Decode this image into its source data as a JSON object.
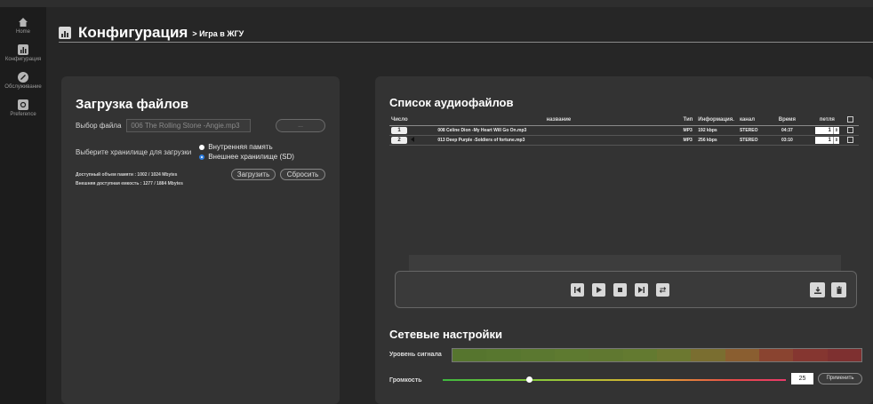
{
  "sidebar": {
    "items": [
      {
        "label": "Home",
        "icon": "home-icon"
      },
      {
        "label": "Конфигурация",
        "icon": "chart-icon"
      },
      {
        "label": "Обслуживание",
        "icon": "wrench-icon"
      },
      {
        "label": "Preference",
        "icon": "gear-icon"
      }
    ]
  },
  "header": {
    "title": "Конфигурация",
    "breadcrumb": "> Игра в ЖГУ"
  },
  "upload": {
    "title": "Загрузка файлов",
    "file_label": "Выбор файла",
    "file_value": "006 The Rolling Stone -Angie.mp3",
    "browse_label": "...",
    "storage_label": "Выберите хранилище для загрузки",
    "storage_options": [
      "Внутренняя память",
      "Внешнее хранилище (SD)"
    ],
    "storage_selected": "Внешнее хранилище (SD)",
    "mem_internal": "Доступный объем памяти : 1002 / 1024 Mbytes",
    "mem_external": "Внешняя доступная емкость : 1277 / 1884 Mbytes",
    "upload_button": "Загрузить",
    "reset_button": "Сбросить"
  },
  "audio": {
    "title": "Список аудиофайлов",
    "columns": [
      "Число",
      "название",
      "Тип",
      "Информация.",
      "канал",
      "Время",
      "петля"
    ],
    "rows": [
      {
        "num": "1",
        "name": "008 Celine Dion -My Heart Will Go On.mp3",
        "type": "MP3",
        "info": "192 kbps",
        "channel": "STEREO",
        "time": "04:37",
        "loop": "1"
      },
      {
        "num": "2",
        "name": "013 Deep Purple -Soldiers of fortune.mp3",
        "type": "MP3",
        "info": "256 kbps",
        "channel": "STEREO",
        "time": "03:10",
        "loop": "1"
      }
    ]
  },
  "network": {
    "title": "Сетевые настройки",
    "signal_label": "Уровень сигнала",
    "volume_label": "Громкость",
    "volume_value": "25",
    "volume_fraction": 0.25,
    "apply_button": "Применить"
  },
  "colors": {
    "accent_radio": "#2f7fe0",
    "signal": [
      "#56752e",
      "#58772f",
      "#5b7830",
      "#5e7a30",
      "#607830",
      "#637a30",
      "#6c7830",
      "#7a6e30",
      "#8a5e30",
      "#8a4430",
      "#853630",
      "#7e3030"
    ]
  }
}
